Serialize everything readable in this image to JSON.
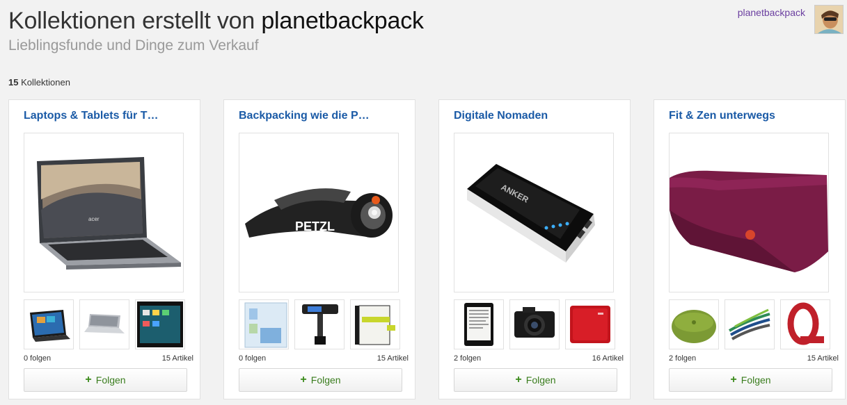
{
  "header": {
    "title_prefix": "Kollektionen erstellt von ",
    "owner": "planetbackpack",
    "subtitle": "Lieblingsfunde und Dinge zum Verkauf"
  },
  "user": {
    "name": "planetbackpack"
  },
  "summary": {
    "count": "15",
    "label": "Kollektionen"
  },
  "follow_label": "Folgen",
  "collections": [
    {
      "title": "Laptops & Tablets für T…",
      "follows": "0 folgen",
      "articles": "15 Artikel"
    },
    {
      "title": "Backpacking wie die P…",
      "follows": "0 folgen",
      "articles": "15 Artikel"
    },
    {
      "title": "Digitale Nomaden",
      "follows": "2 folgen",
      "articles": "16 Artikel"
    },
    {
      "title": "Fit & Zen unterwegs",
      "follows": "2 folgen",
      "articles": "15 Artikel"
    }
  ],
  "image_text": {
    "headlamp_brand": "PETZL",
    "powerbank_brand": "ANKER",
    "laptop_brand": "acer"
  }
}
